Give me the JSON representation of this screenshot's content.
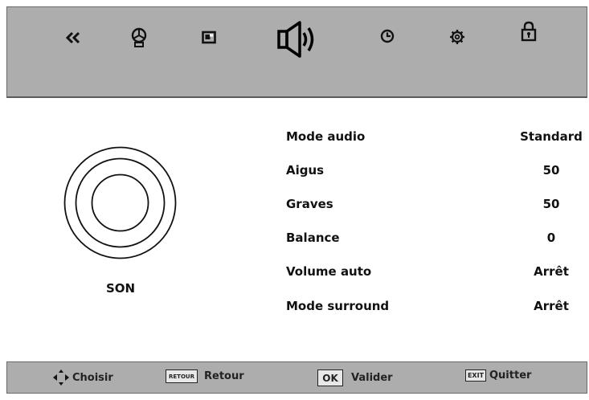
{
  "top_menu": {
    "icons": [
      {
        "name": "back-chevrons-icon"
      },
      {
        "name": "picture-icon"
      },
      {
        "name": "screen-icon"
      },
      {
        "name": "speaker-icon",
        "active": true
      },
      {
        "name": "clock-icon"
      },
      {
        "name": "gear-icon"
      },
      {
        "name": "lock-icon"
      }
    ]
  },
  "section": {
    "title": "SON"
  },
  "settings": [
    {
      "label": "Mode audio",
      "value": "Standard"
    },
    {
      "label": "Aigus",
      "value": "50"
    },
    {
      "label": "Graves",
      "value": "50"
    },
    {
      "label": "Balance",
      "value": "0"
    },
    {
      "label": "Volume auto",
      "value": "Arrêt"
    },
    {
      "label": "Mode surround",
      "value": "Arrêt"
    }
  ],
  "footer": {
    "choose_label": "Choisir",
    "back_key": "RETOUR",
    "back_label": "Retour",
    "ok_key": "OK",
    "ok_label": "Valider",
    "exit_key": "EXIT",
    "exit_label": "Quitter"
  },
  "colors": {
    "bar_background": "#adadad",
    "panel_background": "#ffffff",
    "text": "#111111"
  }
}
